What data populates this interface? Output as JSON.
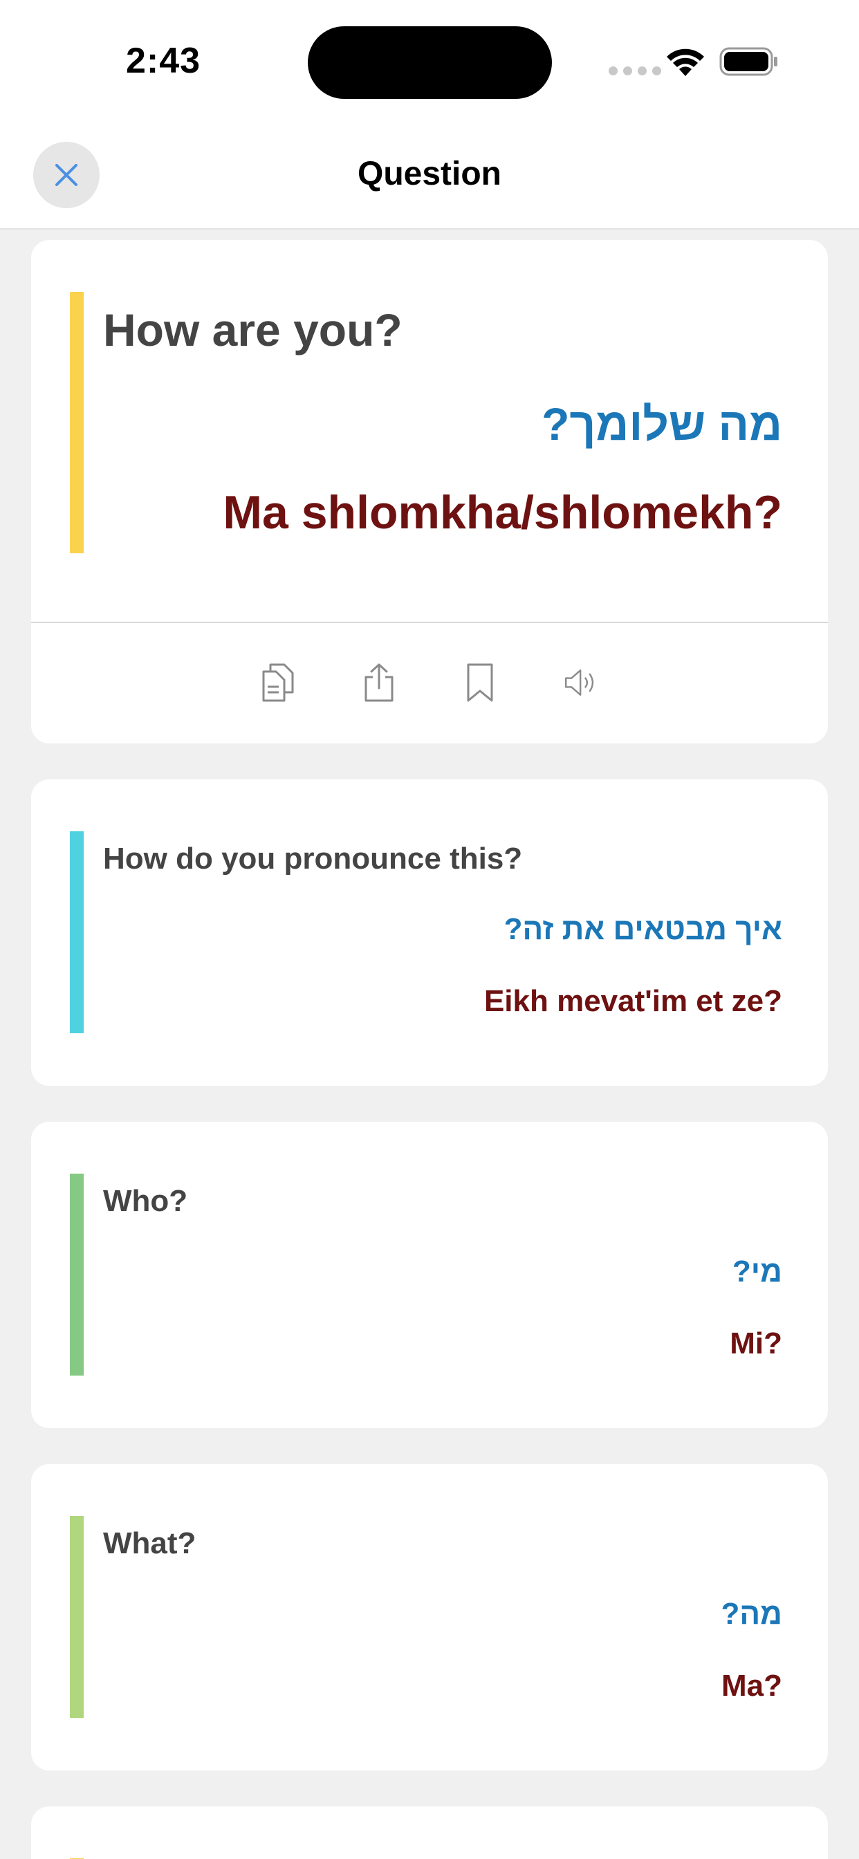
{
  "status_bar": {
    "time": "2:43"
  },
  "header": {
    "title": "Question",
    "close_icon": "close-icon"
  },
  "colors": {
    "english": "#444444",
    "hebrew": "#1b77b8",
    "transliteration": "#6e1111",
    "accents": [
      "#fbd24e",
      "#4fd1e0",
      "#85c985",
      "#b0d67e",
      "#fbd24e"
    ]
  },
  "phrases": [
    {
      "english": "How are you?",
      "hebrew": "מה שלומך?",
      "transliteration": "Ma shlomkha/shlomekh?",
      "actions": [
        "copy-icon",
        "share-icon",
        "bookmark-icon",
        "speaker-icon"
      ]
    },
    {
      "english": "How do you pronounce this?",
      "hebrew": "איך מבטאים את זה?",
      "transliteration": "Eikh mevat'im et ze?"
    },
    {
      "english": "Who?",
      "hebrew": "מי?",
      "transliteration": "Mi?"
    },
    {
      "english": "What?",
      "hebrew": "מה?",
      "transliteration": "Ma?"
    }
  ]
}
